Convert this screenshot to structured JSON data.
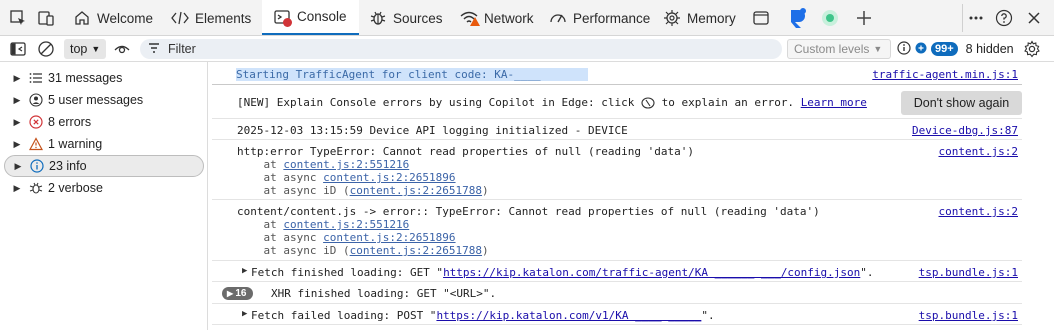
{
  "tabs": {
    "welcome": "Welcome",
    "elements": "Elements",
    "console": "Console",
    "sources": "Sources",
    "network": "Network",
    "performance": "Performance",
    "memory": "Memory"
  },
  "toolbar": {
    "context": "top",
    "filter_placeholder": "Filter",
    "levels": "Custom levels",
    "issues_count": "99+",
    "hidden": "8 hidden"
  },
  "sidebar": {
    "items": [
      {
        "label": "31 messages",
        "icon": "list-icon"
      },
      {
        "label": "5 user messages",
        "icon": "user-icon"
      },
      {
        "label": "8 errors",
        "icon": "error-icon"
      },
      {
        "label": "1 warning",
        "icon": "warning-icon"
      },
      {
        "label": "23 info",
        "icon": "info-icon"
      },
      {
        "label": "2 verbose",
        "icon": "bug-icon"
      }
    ]
  },
  "console": {
    "m1": {
      "text": "Starting TrafficAgent for client code: KA-____",
      "source": "traffic-agent.min.js:1"
    },
    "m2": {
      "pre": "[NEW] Explain Console errors by using Copilot in Edge: click ",
      "post": " to explain an error. ",
      "link": "Learn more",
      "button": "Don't show again"
    },
    "m3": {
      "text": "2025-12-03 13:15:59 Device API logging initialized - DEVICE",
      "source": "Device-dbg.js:87"
    },
    "m4": {
      "text": "http:error TypeError: Cannot read properties of null (reading 'data')",
      "source": "content.js:2",
      "stack": [
        {
          "pre": "    at ",
          "link": "content.js:2:551216",
          "post": ""
        },
        {
          "pre": "    at async ",
          "link": "content.js:2:2651896",
          "post": ""
        },
        {
          "pre": "    at async iD (",
          "link": "content.js:2:2651788",
          "post": ")"
        }
      ]
    },
    "m5": {
      "text": "content/content.js -> error:: TypeError: Cannot read properties of null (reading 'data')",
      "source": "content.js:2",
      "stack": [
        {
          "pre": "    at ",
          "link": "content.js:2:551216",
          "post": ""
        },
        {
          "pre": "    at async ",
          "link": "content.js:2:2651896",
          "post": ""
        },
        {
          "pre": "    at async iD (",
          "link": "content.js:2:2651788",
          "post": ")"
        }
      ]
    },
    "m6": {
      "pre": "Fetch finished loading: GET \"",
      "link": "https://kip.katalon.com/traffic-agent/KA ______ ___/config.json",
      "post": "\".",
      "source": "tsp.bundle.js:1"
    },
    "m7": {
      "count": "16",
      "text": "XHR finished loading: GET \"<URL>\"."
    },
    "m8": {
      "pre": "Fetch failed loading: POST \"",
      "link": "https://kip.katalon.com/v1/KA ____ _____",
      "post": "\".",
      "source": "tsp.bundle.js:1"
    }
  },
  "colors": {
    "accent": "#0f6cbd",
    "error": "#d13438",
    "link": "#1a0dab"
  }
}
